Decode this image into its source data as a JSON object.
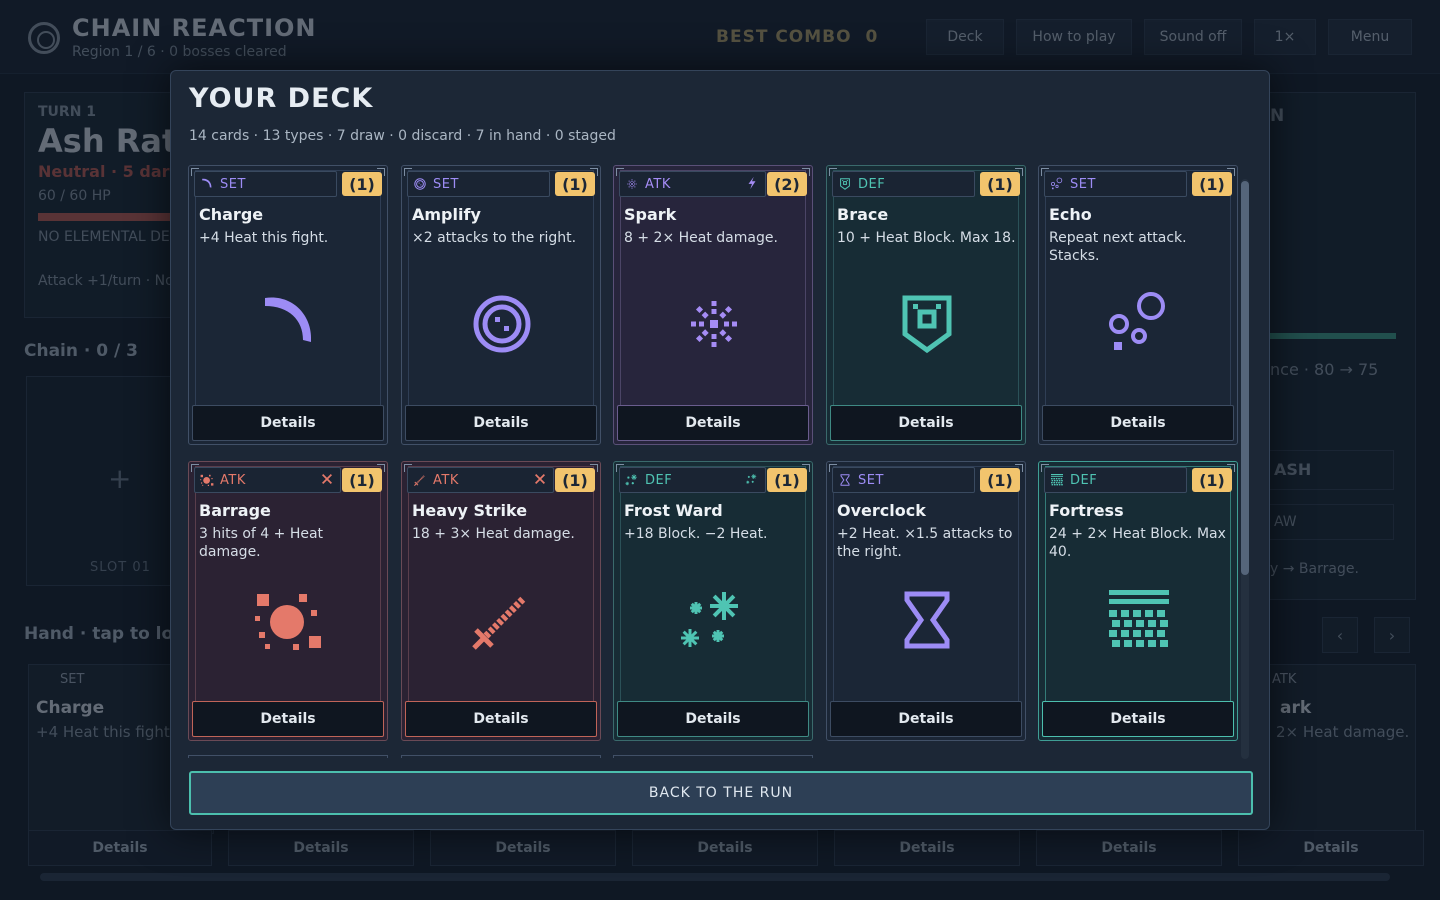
{
  "header": {
    "title": "CHAIN REACTION",
    "subtitle": "Region 1 / 6 · 0 bosses cleared",
    "best_combo_label": "BEST COMBO",
    "best_combo_value": "0",
    "buttons": [
      "Deck",
      "How to play",
      "Sound off",
      "1×",
      "Menu"
    ]
  },
  "enemy": {
    "turn": "TURN 1",
    "name": "Ash Rat",
    "trait": "Neutral · 5 dar",
    "hp": "60 / 60 HP",
    "elemental": "NO ELEMENTAL DE",
    "intent": "Attack +1/turn · No"
  },
  "chain": {
    "label": "Chain · 0 / 3",
    "slot_label": "SLOT 01",
    "plus": "+"
  },
  "hand": {
    "label": "Hand · tap to loa"
  },
  "right_panel": {
    "title_fragment": "N",
    "distance": "nce · 80 → 75",
    "button1": "ASH",
    "button2": "AW",
    "hint": "y → Barrage."
  },
  "hand_cards": [
    {
      "type": "SET",
      "name": "Charge",
      "text": "+4 Heat this fight.",
      "details": "Details"
    },
    {
      "details": "Details"
    },
    {
      "details": "Details"
    },
    {
      "details": "Details"
    },
    {
      "details": "Details"
    },
    {
      "details": "Details"
    },
    {
      "type": "ATK",
      "name": "ark",
      "text": "2× Heat damage.",
      "details": "Details"
    }
  ],
  "modal": {
    "title": "YOUR DECK",
    "summary": "14 cards · 13 types · 7 draw · 0 discard · 7 in hand · 0 staged",
    "back_button": "BACK TO THE RUN",
    "details_label": "Details",
    "cards": [
      {
        "type": "SET",
        "count": "(1)",
        "name": "Charge",
        "text": "+4 Heat this fight.",
        "icon": "crescent-icon",
        "extra_icon": "",
        "color": "#9d8cf5",
        "theme": "set"
      },
      {
        "type": "SET",
        "count": "(1)",
        "name": "Amplify",
        "text": "×2 attacks to the right.",
        "icon": "target-icon",
        "extra_icon": "",
        "color": "#9d8cf5",
        "theme": "set"
      },
      {
        "type": "ATK",
        "count": "(2)",
        "name": "Spark",
        "text": "8 + 2× Heat damage.",
        "icon": "spark-icon",
        "extra_icon": "lightning-icon",
        "color": "#a58cf5",
        "theme": "atk-purple"
      },
      {
        "type": "DEF",
        "count": "(1)",
        "name": "Brace",
        "text": "10 + Heat Block. Max 18.",
        "icon": "shield-icon",
        "extra_icon": "",
        "color": "#4fc4b3",
        "theme": "def"
      },
      {
        "type": "SET",
        "count": "(1)",
        "name": "Echo",
        "text": "Repeat next attack. Stacks.",
        "icon": "bubbles-icon",
        "extra_icon": "",
        "color": "#9d8cf5",
        "theme": "set"
      },
      {
        "type": "ATK",
        "count": "(1)",
        "name": "Barrage",
        "text": "3 hits of 4 + Heat damage.",
        "icon": "burst-icon",
        "extra_icon": "cross-icon",
        "color": "#e4796a",
        "theme": "atk-red"
      },
      {
        "type": "ATK",
        "count": "(1)",
        "name": "Heavy Strike",
        "text": "18 + 3× Heat damage.",
        "icon": "sword-icon",
        "extra_icon": "cross-icon",
        "color": "#e4796a",
        "theme": "atk-red"
      },
      {
        "type": "DEF",
        "count": "(1)",
        "name": "Frost Ward",
        "text": "+18 Block. −2 Heat.",
        "icon": "snowflake-icon",
        "extra_icon": "snowflake-icon",
        "color": "#4fc4b3",
        "theme": "def"
      },
      {
        "type": "SET",
        "count": "(1)",
        "name": "Overclock",
        "text": "+2 Heat. ×1.5 attacks to the right.",
        "icon": "hourglass-icon",
        "extra_icon": "",
        "color": "#9d8cf5",
        "theme": "set"
      },
      {
        "type": "DEF",
        "count": "(1)",
        "name": "Fortress",
        "text": "24 + 2× Heat Block. Max 40.",
        "icon": "fortress-icon",
        "extra_icon": "",
        "color": "#4fc4b3",
        "theme": "def-bright"
      }
    ]
  }
}
